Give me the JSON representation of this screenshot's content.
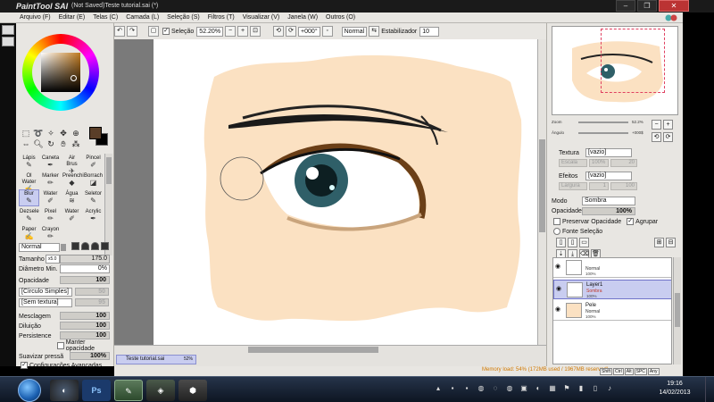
{
  "window": {
    "logo": "PaintTool SAI",
    "title": "(Not Saved)Teste tutorial.sai (*)",
    "controls": [
      "–",
      "❐",
      "✕"
    ]
  },
  "menu": [
    "Arquivo (F)",
    "Editar (E)",
    "Telas (C)",
    "Camada (L)",
    "Seleção (S)",
    "Filtros (T)",
    "Visualizar (V)",
    "Janela (W)",
    "Outros (O)"
  ],
  "toolbar": {
    "selection_label": "Seleção",
    "zoom": "52.20%",
    "rotation": "+000°",
    "mode": "Normal",
    "stabilizer_label": "Estabilizador",
    "stabilizer_value": "10"
  },
  "colors": {
    "foreground": "#5a3e28",
    "background": "#000000",
    "accent": "#c9cdf0",
    "skin": "#fbe1c2"
  },
  "tools": [
    {
      "label": "Lápis",
      "icon": "pencil-icon"
    },
    {
      "label": "Caneta",
      "icon": "pen-icon"
    },
    {
      "label": "Air Brus",
      "icon": "airbrush-icon"
    },
    {
      "label": "Pincel",
      "icon": "brush-icon"
    },
    {
      "label": "Ol Water",
      "icon": "water-icon"
    },
    {
      "label": "Marker",
      "icon": "marker-icon"
    },
    {
      "label": "Preenchi",
      "icon": "fill-icon"
    },
    {
      "label": "Borrach",
      "icon": "eraser-icon"
    },
    {
      "label": "Blur",
      "icon": "blur-icon"
    },
    {
      "label": "Water",
      "icon": "water-icon"
    },
    {
      "label": "Água",
      "icon": "water-icon"
    },
    {
      "label": "Seletor",
      "icon": "selector-icon"
    },
    {
      "label": "Dezsele",
      "icon": "deselect-icon"
    },
    {
      "label": "Pixel",
      "icon": "pixel-icon"
    },
    {
      "label": "Water",
      "icon": "water-icon"
    },
    {
      "label": "Acrylic",
      "icon": "acrylic-icon"
    },
    {
      "label": "Paper",
      "icon": "paper-icon"
    },
    {
      "label": "Crayon",
      "icon": "crayon-icon"
    }
  ],
  "brush": {
    "blend_mode": "Normal",
    "size_label": "Tamanho",
    "size_multiplier": "x5.0",
    "size_value": "175.0",
    "min_diameter_label": "Diâmetro Min.",
    "min_diameter_value": "0%",
    "opacity_label": "Opacidade",
    "opacity_value": "100",
    "shape": "[Círculo Simples]",
    "shape_value": "50",
    "texture": "[Sem textura]",
    "texture_value": "95",
    "blend_label": "Mesclagem",
    "blend_value": "100",
    "dilution_label": "Diluição",
    "dilution_value": "100",
    "persistence_label": "Persistence",
    "persistence_value": "100",
    "keep_opacity_label": "Manter opacidade",
    "smooth_label": "Suavizar pressã",
    "smooth_value": "100%",
    "advanced_label": "Configurações Avançadas"
  },
  "document": {
    "tab_name": "Teste tutorial.sai",
    "tab_zoom": "52%"
  },
  "navigator": {
    "zoom_label": "Zoom",
    "zoom_value": "52.2%",
    "angle_label": "Ângulo",
    "angle_value": "+000$"
  },
  "layer_panel": {
    "texture_label": "Textura",
    "texture_value": "[vazio]",
    "effects_label": "Efeitos",
    "effects_value": "[vazio]",
    "mode_label": "Modo",
    "mode_value": "Sombra",
    "opacity_label": "Opacidade",
    "opacity_value": "100%",
    "preserve_label": "Preservar Opacidade",
    "group_label": "Agrupar",
    "source_label": "Fonte Seleção",
    "tex_scale_label": "Escala",
    "tex_scale_value": "100%",
    "tex_strength_value": "20",
    "effects_strength_label": "Largura",
    "effects_strength_value": "1",
    "effects_strength_value2": "100"
  },
  "layers": [
    {
      "name": "",
      "mode": "Normal",
      "opacity": "100%",
      "selected": false
    },
    {
      "name": "Layer1",
      "mode": "Sombra",
      "opacity": "100%",
      "selected": true
    },
    {
      "name": "Pele",
      "mode": "Normal",
      "opacity": "100%",
      "selected": false
    }
  ],
  "status": {
    "memory": "Memory load: 54% (172MB used / 1967MB reserved)",
    "ime_keys": [
      "Shift",
      "Ctrl",
      "Alt",
      "SPC",
      "Any"
    ]
  },
  "taskbar": {
    "apps": [
      "Windows Explorer",
      "Chrome",
      "Photoshop",
      "PaintTool SAI",
      "Game",
      "App"
    ],
    "time": "19:16",
    "date": "14/02/2013"
  }
}
